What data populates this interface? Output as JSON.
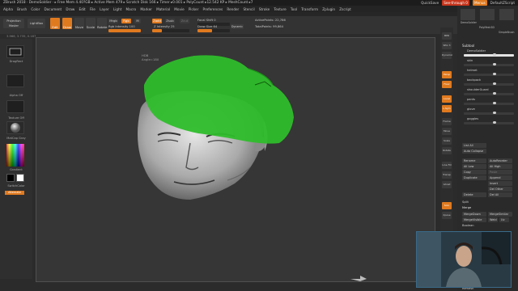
{
  "titlebar": {
    "left": "ZBrush 2018 · DemoSoldier · ▸ Free Mem 4.40?GB ▸ Active Mem 479 ▸ Scratch Disk 166 ▸ Timer ▸0.001 ▸ PolyCount ▸12.542 KP ▸ MeshCount ▸7",
    "quicksave": "QuickSave",
    "seethrough": "See-through 0",
    "menus": "Menus",
    "script": "DefaultZScript"
  },
  "menu": [
    "Alpha",
    "Brush",
    "Color",
    "Document",
    "Draw",
    "Edit",
    "File",
    "Layer",
    "Light",
    "Macro",
    "Marker",
    "Material",
    "Movie",
    "Picker",
    "Preferences",
    "Render",
    "Stencil",
    "Stroke",
    "Texture",
    "Tool",
    "Transform",
    "Zplugin",
    "Zscript"
  ],
  "toolbar": {
    "projection_master": "Projection Master",
    "lightbox": "LightBox",
    "edit": "Edit",
    "draw": "Draw",
    "move": "Move",
    "scale": "Scale",
    "rotate": "Rotate",
    "mrgb": "Mrgb",
    "rgb": "Rgb",
    "m": "M",
    "rgb_intensity": "Rgb Intensity 100",
    "zadd": "Zadd",
    "zsub": "Zsub",
    "zcut": "Zcut",
    "z_intensity": "Z Intensity 25",
    "focal_shift": "Focal Shift 0",
    "draw_size": "Draw Size 64",
    "dynamic": "Dynamic",
    "active_points": "ActivePoints: 22,786",
    "total_points": "TotalPoints: 99,864"
  },
  "coords": "3.966, 3.735, 0.187",
  "leftshelf": {
    "stroke": "DragRect",
    "alpha": "Alpha Off",
    "texture": "Texture Off",
    "material": "MatCap Gray",
    "gradient": "Gradient",
    "switch": "SwitchColor",
    "alternate": "Alternate"
  },
  "hud": {
    "line1": "HDB",
    "line2": "Angle=180"
  },
  "rtools": [
    "BPR",
    "SPix 3",
    "Dynamic",
    "Persp",
    "Floor",
    "Local",
    "L.Sym",
    "Frame",
    "Move",
    "Scale",
    "Rotate",
    "Line Fill",
    "Transp",
    "Ghost",
    "Solo",
    "Xpose"
  ],
  "rpanel": {
    "top": [
      "DemoSoldier",
      "PolyMesh3D",
      "SimpleBrush"
    ],
    "subtool": "Subtool",
    "items": [
      "DemoSoldier",
      "skin",
      "helmet",
      "backpack",
      "shoulderGuard",
      "pants",
      "glove",
      "goggles"
    ],
    "list_all": "List All",
    "auto_collapse": "Auto Collapse",
    "rename": "Rename",
    "autoreorder": "AutoReorder",
    "all_low": "All Low",
    "all_high": "All High",
    "copy": "Copy",
    "paste": "Paste",
    "duplicate": "Duplicate",
    "append": "Append",
    "insert": "Insert",
    "del_other": "Del Other",
    "delete": "Delete",
    "del_all": "Del All",
    "split": "Split",
    "merge": "Merge",
    "mergedown": "MergeDown",
    "mergesimilar": "MergeSimilar",
    "mergevisible": "MergeVisible",
    "weld": "Weld",
    "uv": "Uv",
    "boolean": "Boolean",
    "remesh": "Remesh"
  },
  "colors": {
    "accent": "#e07a1f",
    "cap": "#2fbd2b"
  }
}
